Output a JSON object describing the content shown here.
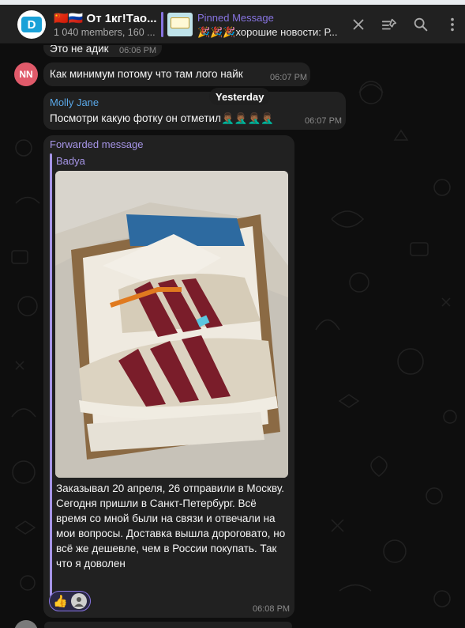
{
  "header": {
    "title": "🇨🇳🇷🇺 От 1кг!Тао...",
    "subtitle": "1 040 members, 160 ...",
    "avatar_letter": "D",
    "pinned_label": "Pinned Message",
    "pinned_preview": "🎉🎉🎉хорошие новости: Р...",
    "icons": [
      "close-icon",
      "pin-list-icon",
      "search-icon",
      "more-vertical-icon"
    ]
  },
  "chat": {
    "messages": [
      {
        "text": "Это не адик",
        "time": "06:06 PM"
      },
      {
        "avatar": "NN",
        "text": "Как минимум потому что там лого найк",
        "time": "06:07 PM"
      },
      {
        "sender": "Molly Jane",
        "text": "Посмотри какую фотку он отметил🤦🏾‍♂️🤦🏾‍♂️🤦🏾‍♂️🤦🏾‍♂️",
        "time": "06:07 PM"
      },
      {
        "forwarded_label": "Forwarded message",
        "original_sender": "Badya",
        "text": "Заказывал 20 апреля, 26 отправили в Москву. Сегодня пришли в Санкт-Петербург. Всё время со мной были на связи и отвечали на мои вопросы. Доставка вышла дороговато, но всё же дешевле, чем в России покупать. Так что я доволен",
        "time": "06:08 PM",
        "reaction": "👍"
      }
    ],
    "date_pill": "Yesterday"
  },
  "colors": {
    "accent": "#8774e1",
    "sender_name": "#5aa8e8",
    "bubble": "#212121",
    "nn_avatar": "#e05a6a"
  }
}
